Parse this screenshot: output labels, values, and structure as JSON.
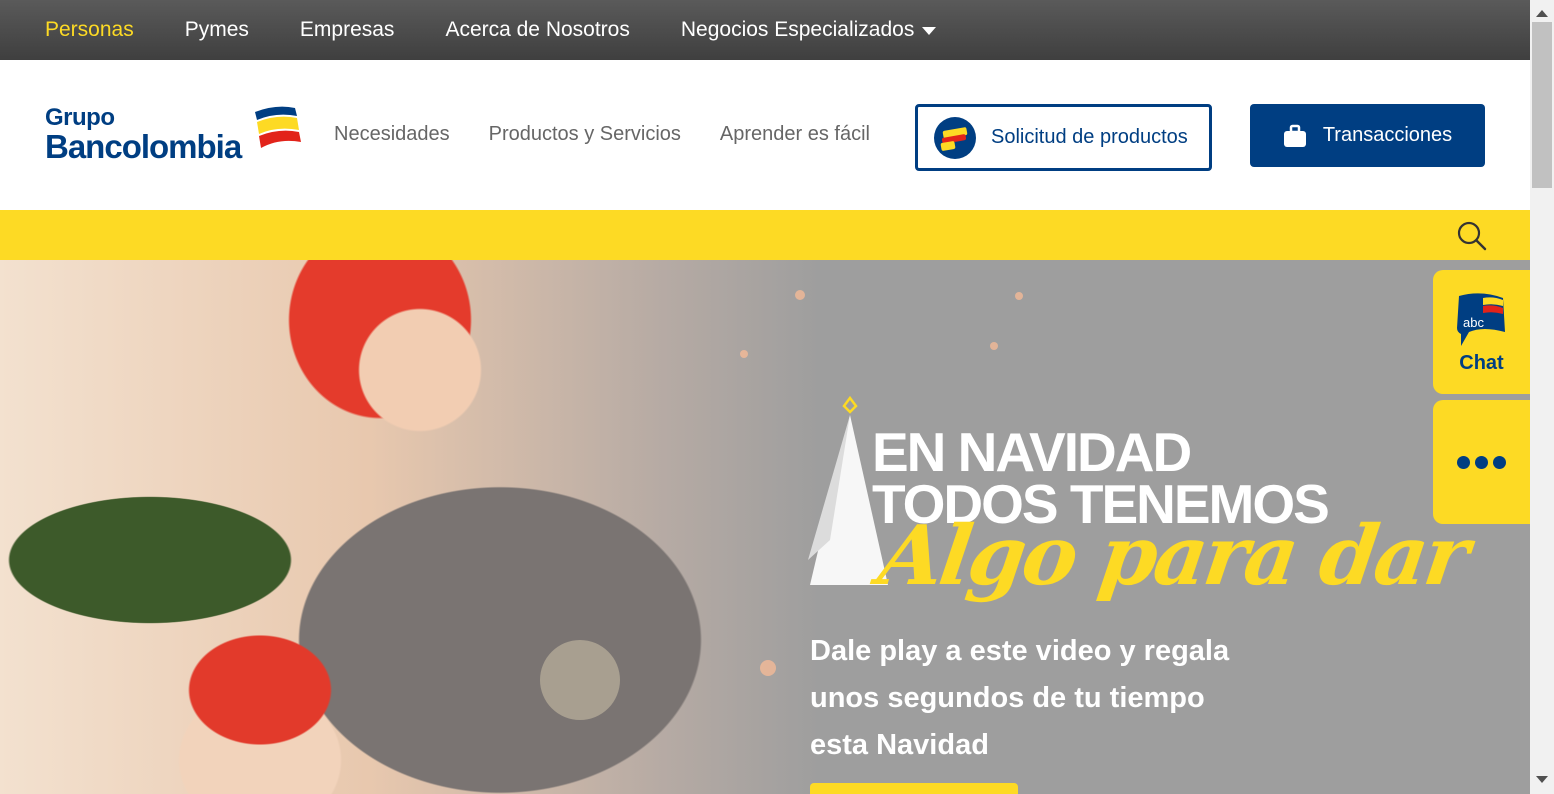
{
  "topnav": {
    "items": [
      {
        "label": "Personas",
        "active": true
      },
      {
        "label": "Pymes"
      },
      {
        "label": "Empresas"
      },
      {
        "label": "Acerca de Nosotros"
      },
      {
        "label": "Negocios Especializados",
        "dropdown": true
      }
    ]
  },
  "header": {
    "logo": {
      "line1": "Grupo",
      "line2": "Bancolombia"
    },
    "nav": [
      "Necesidades",
      "Productos y Servicios",
      "Aprender es fácil"
    ],
    "solicitud_label": "Solicitud de productos",
    "transacciones_label": "Transacciones"
  },
  "hero": {
    "title_line1": "En Navidad",
    "title_line2": "Todos tenemos",
    "title_script": "Algo para dar",
    "subtitle": "Dale play a este video y regala unos segundos de tu tiempo esta Navidad"
  },
  "side": {
    "chat_label": "Chat",
    "chat_icon_text": "abc"
  },
  "colors": {
    "brand_blue": "#003e82",
    "brand_yellow": "#fdda24",
    "topbar": "#4a4a4a"
  },
  "icons": [
    "search-icon",
    "briefcase-icon",
    "chat-bubble-icon",
    "more-dots-icon",
    "chevron-down-icon"
  ]
}
